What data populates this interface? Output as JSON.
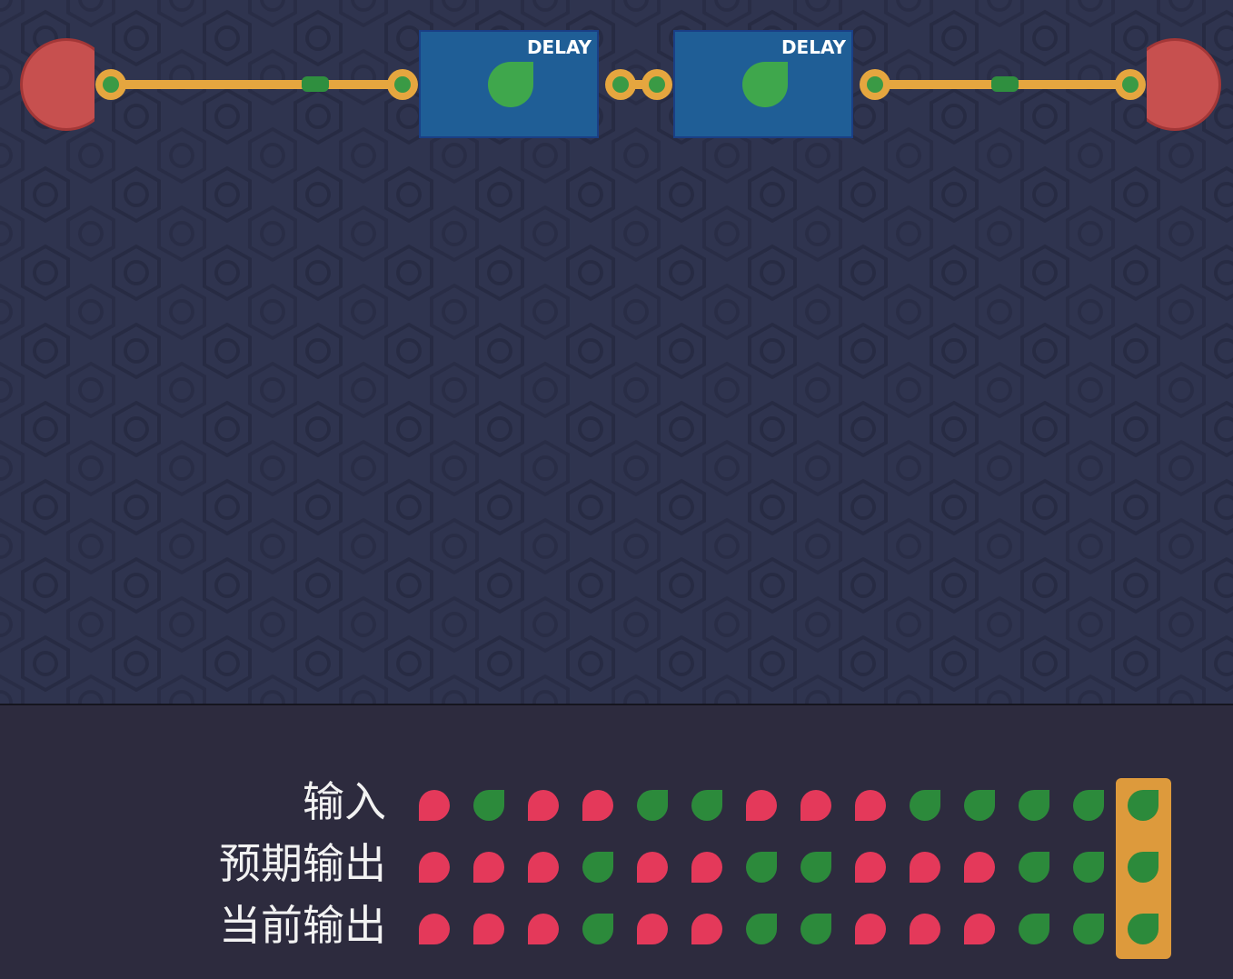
{
  "circuit": {
    "gates": [
      {
        "label": "DELAY",
        "state": "on"
      },
      {
        "label": "DELAY",
        "state": "on"
      }
    ],
    "wires": [
      {
        "state": "on"
      },
      {
        "state": "on"
      },
      {
        "state": "on"
      }
    ]
  },
  "truth_table": {
    "rows": [
      {
        "label": "输入",
        "values": [
          0,
          1,
          0,
          0,
          1,
          1,
          0,
          0,
          0,
          1,
          1,
          1,
          1,
          1
        ]
      },
      {
        "label": "预期输出",
        "values": [
          0,
          0,
          0,
          1,
          0,
          0,
          1,
          1,
          0,
          0,
          0,
          1,
          1,
          1
        ]
      },
      {
        "label": "当前输出",
        "values": [
          0,
          0,
          0,
          1,
          0,
          0,
          1,
          1,
          0,
          0,
          0,
          1,
          1,
          1
        ]
      }
    ],
    "highlighted_step": 14
  },
  "colors": {
    "board_bg": "#2f344f",
    "panel_bg": "#2d2b3e",
    "signal_on": "#2c8a3b",
    "signal_off": "#e4395a",
    "wire": "#e5a63f",
    "gate_fill": "#1f5e96",
    "endpoint": "#c7504f",
    "highlight": "#dd9a3c"
  }
}
